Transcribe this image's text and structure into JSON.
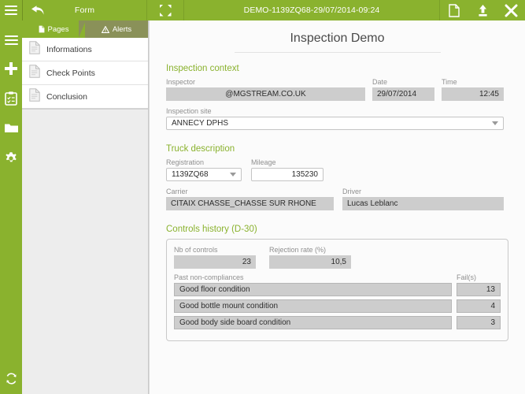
{
  "topbar": {
    "menu_icon": "hamburger-menu-icon",
    "back_icon": "back-arrow-icon",
    "form_label": "Form",
    "expand_icon": "fullscreen-expand-icon",
    "document_title": "DEMO-1139ZQ68-29/07/2014-09:24",
    "new_doc_icon": "document-page-icon",
    "upload_icon": "upload-icon",
    "close_icon": "close-x-icon"
  },
  "rail": {
    "icons": [
      "hamburger-menu-icon",
      "add-plus-icon",
      "clipboard-checklist-icon",
      "folder-icon",
      "settings-gear-icon"
    ],
    "bottom_icon": "sync-refresh-icon"
  },
  "panel": {
    "tabs": [
      {
        "label": "Pages",
        "icon": "page-document-icon",
        "active": true
      },
      {
        "label": "Alerts",
        "icon": "warning-triangle-icon",
        "active": false
      }
    ],
    "pages": [
      {
        "label": "Informations",
        "icon": "page-document-icon"
      },
      {
        "label": "Check Points",
        "icon": "page-document-icon"
      },
      {
        "label": "Conclusion",
        "icon": "page-document-icon"
      }
    ]
  },
  "form": {
    "title": "Inspection Demo",
    "sections": {
      "context": {
        "title": "Inspection context",
        "inspector_label": "Inspector",
        "inspector_value": "@MGSTREAM.CO.UK",
        "date_label": "Date",
        "date_value": "29/07/2014",
        "time_label": "Time",
        "time_value": "12:45",
        "site_label": "Inspection site",
        "site_value": "ANNECY DPHS"
      },
      "truck": {
        "title": "Truck description",
        "registration_label": "Registration",
        "registration_value": "1139ZQ68",
        "mileage_label": "Mileage",
        "mileage_value": "135230",
        "carrier_label": "Carrier",
        "carrier_value": "CITAIX CHASSE_CHASSE SUR RHONE",
        "driver_label": "Driver",
        "driver_value": "Lucas Leblanc"
      },
      "history": {
        "title": "Controls history (D-30)",
        "nb_controls_label": "Nb of controls",
        "nb_controls_value": "23",
        "rejection_rate_label": "Rejection rate (%)",
        "rejection_rate_value": "10,5",
        "past_label": "Past non-compliances",
        "fails_label": "Fail(s)",
        "items": [
          {
            "name": "Good floor condition",
            "fails": "13"
          },
          {
            "name": "Good bottle mount condition",
            "fails": "4"
          },
          {
            "name": "Good body side board condition",
            "fails": "3"
          }
        ]
      }
    }
  },
  "colors": {
    "brand_green": "#8ab22e",
    "tab_inactive": "#8a9159",
    "field_readonly": "#cdcdcd",
    "panel_bg": "#ededed",
    "main_bg": "#fbfbfb"
  }
}
